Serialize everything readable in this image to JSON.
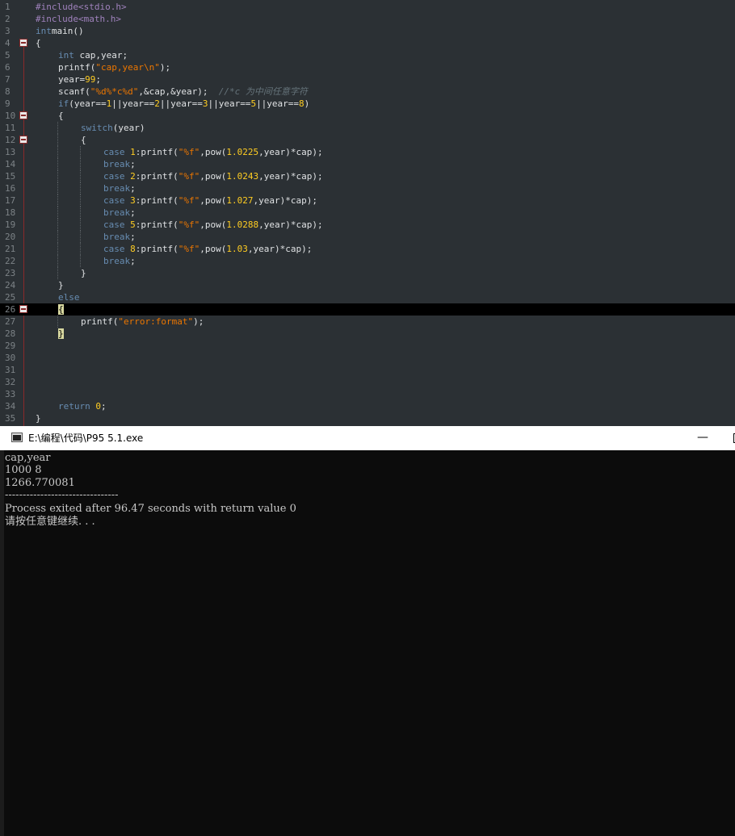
{
  "editor": {
    "lines": [
      {
        "n": "1",
        "fold": false,
        "indent": 0,
        "tokens": [
          [
            "pp",
            "#include"
          ],
          [
            "pp",
            "<stdio.h>"
          ]
        ]
      },
      {
        "n": "2",
        "fold": false,
        "indent": 0,
        "tokens": [
          [
            "pp",
            "#include"
          ],
          [
            "pp",
            "<math.h>"
          ]
        ]
      },
      {
        "n": "3",
        "fold": false,
        "indent": 0,
        "tokens": [
          [
            "kw2",
            "int"
          ],
          [
            "",
            "main()"
          ]
        ]
      },
      {
        "n": "4",
        "fold": true,
        "indent": 0,
        "tokens": [
          [
            "",
            "{"
          ]
        ]
      },
      {
        "n": "5",
        "fold": false,
        "indent": 1,
        "tokens": [
          [
            "kw2",
            "int"
          ],
          [
            "",
            " cap,year;"
          ]
        ]
      },
      {
        "n": "6",
        "fold": false,
        "indent": 1,
        "tokens": [
          [
            "",
            "printf("
          ],
          [
            "str",
            "\"cap,year\\n\""
          ],
          [
            "",
            ");"
          ]
        ]
      },
      {
        "n": "7",
        "fold": false,
        "indent": 1,
        "tokens": [
          [
            "",
            "year="
          ],
          [
            "num",
            "99"
          ],
          [
            "",
            ";"
          ]
        ]
      },
      {
        "n": "8",
        "fold": false,
        "indent": 1,
        "tokens": [
          [
            "",
            "scanf("
          ],
          [
            "str",
            "\"%d%*c%d\""
          ],
          [
            "",
            ",&cap,&year);  "
          ],
          [
            "cmt",
            "//*c 为中间任意字符"
          ]
        ]
      },
      {
        "n": "9",
        "fold": false,
        "indent": 1,
        "tokens": [
          [
            "kw2",
            "if"
          ],
          [
            "",
            "(year=="
          ],
          [
            "num",
            "1"
          ],
          [
            "",
            "||year=="
          ],
          [
            "num",
            "2"
          ],
          [
            "",
            "||year=="
          ],
          [
            "num",
            "3"
          ],
          [
            "",
            "||year=="
          ],
          [
            "num",
            "5"
          ],
          [
            "",
            "||year=="
          ],
          [
            "num",
            "8"
          ],
          [
            "",
            ")"
          ]
        ]
      },
      {
        "n": "10",
        "fold": true,
        "indent": 1,
        "tokens": [
          [
            "",
            "{"
          ]
        ]
      },
      {
        "n": "11",
        "fold": false,
        "indent": 2,
        "tokens": [
          [
            "kw2",
            "switch"
          ],
          [
            "",
            "(year)"
          ]
        ]
      },
      {
        "n": "12",
        "fold": true,
        "indent": 2,
        "tokens": [
          [
            "",
            "{"
          ]
        ]
      },
      {
        "n": "13",
        "fold": false,
        "indent": 3,
        "tokens": [
          [
            "kw2",
            "case "
          ],
          [
            "num",
            "1"
          ],
          [
            "",
            ":printf("
          ],
          [
            "str",
            "\"%f\""
          ],
          [
            "",
            ",pow("
          ],
          [
            "num",
            "1.0225"
          ],
          [
            "",
            ",year)*cap);"
          ]
        ]
      },
      {
        "n": "14",
        "fold": false,
        "indent": 3,
        "tokens": [
          [
            "kw2",
            "break"
          ],
          [
            "",
            ";"
          ]
        ]
      },
      {
        "n": "15",
        "fold": false,
        "indent": 3,
        "tokens": [
          [
            "kw2",
            "case "
          ],
          [
            "num",
            "2"
          ],
          [
            "",
            ":printf("
          ],
          [
            "str",
            "\"%f\""
          ],
          [
            "",
            ",pow("
          ],
          [
            "num",
            "1.0243"
          ],
          [
            "",
            ",year)*cap);"
          ]
        ]
      },
      {
        "n": "16",
        "fold": false,
        "indent": 3,
        "tokens": [
          [
            "kw2",
            "break"
          ],
          [
            "",
            ";"
          ]
        ]
      },
      {
        "n": "17",
        "fold": false,
        "indent": 3,
        "tokens": [
          [
            "kw2",
            "case "
          ],
          [
            "num",
            "3"
          ],
          [
            "",
            ":printf("
          ],
          [
            "str",
            "\"%f\""
          ],
          [
            "",
            ",pow("
          ],
          [
            "num",
            "1.027"
          ],
          [
            "",
            ",year)*cap);"
          ]
        ]
      },
      {
        "n": "18",
        "fold": false,
        "indent": 3,
        "tokens": [
          [
            "kw2",
            "break"
          ],
          [
            "",
            ";"
          ]
        ]
      },
      {
        "n": "19",
        "fold": false,
        "indent": 3,
        "tokens": [
          [
            "kw2",
            "case "
          ],
          [
            "num",
            "5"
          ],
          [
            "",
            ":printf("
          ],
          [
            "str",
            "\"%f\""
          ],
          [
            "",
            ",pow("
          ],
          [
            "num",
            "1.0288"
          ],
          [
            "",
            ",year)*cap);"
          ]
        ]
      },
      {
        "n": "20",
        "fold": false,
        "indent": 3,
        "tokens": [
          [
            "kw2",
            "break"
          ],
          [
            "",
            ";"
          ]
        ]
      },
      {
        "n": "21",
        "fold": false,
        "indent": 3,
        "tokens": [
          [
            "kw2",
            "case "
          ],
          [
            "num",
            "8"
          ],
          [
            "",
            ":printf("
          ],
          [
            "str",
            "\"%f\""
          ],
          [
            "",
            ",pow("
          ],
          [
            "num",
            "1.03"
          ],
          [
            "",
            ",year)*cap);"
          ]
        ]
      },
      {
        "n": "22",
        "fold": false,
        "indent": 3,
        "tokens": [
          [
            "kw2",
            "break"
          ],
          [
            "",
            ";"
          ]
        ]
      },
      {
        "n": "23",
        "fold": false,
        "indent": 2,
        "tokens": [
          [
            "",
            "}"
          ]
        ]
      },
      {
        "n": "24",
        "fold": false,
        "indent": 1,
        "tokens": [
          [
            "",
            "}"
          ]
        ]
      },
      {
        "n": "25",
        "fold": false,
        "indent": 1,
        "tokens": [
          [
            "kw2",
            "else"
          ]
        ]
      },
      {
        "n": "26",
        "fold": true,
        "indent": 1,
        "current": true,
        "tokens": [
          [
            "hl",
            "{"
          ]
        ]
      },
      {
        "n": "27",
        "fold": false,
        "indent": 2,
        "tokens": [
          [
            "",
            "printf("
          ],
          [
            "str",
            "\"error:format\""
          ],
          [
            "",
            ");"
          ]
        ]
      },
      {
        "n": "28",
        "fold": false,
        "indent": 1,
        "tokens": [
          [
            "hl",
            "}"
          ]
        ]
      },
      {
        "n": "29",
        "fold": false,
        "indent": 0,
        "tokens": []
      },
      {
        "n": "30",
        "fold": false,
        "indent": 0,
        "tokens": []
      },
      {
        "n": "31",
        "fold": false,
        "indent": 0,
        "tokens": []
      },
      {
        "n": "32",
        "fold": false,
        "indent": 0,
        "tokens": []
      },
      {
        "n": "33",
        "fold": false,
        "indent": 0,
        "tokens": []
      },
      {
        "n": "34",
        "fold": false,
        "indent": 1,
        "tokens": [
          [
            "kw2",
            "return "
          ],
          [
            "num",
            "0"
          ],
          [
            "",
            ";"
          ]
        ]
      },
      {
        "n": "35",
        "fold": false,
        "indent": 0,
        "tokens": [
          [
            "",
            "}"
          ]
        ]
      }
    ]
  },
  "console": {
    "title": "E:\\编程\\代码\\P95 5.1.exe",
    "minimize_label": "—",
    "output": [
      "cap,year",
      "1000 8",
      "1266.770081",
      "--------------------------------",
      "Process exited after 96.47 seconds with return value 0",
      "请按任意键继续. . ."
    ]
  }
}
